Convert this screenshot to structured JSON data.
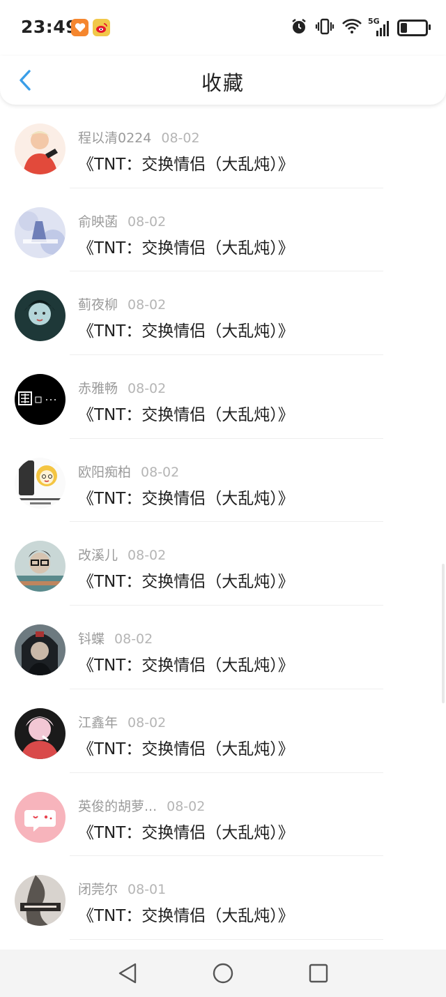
{
  "status_bar": {
    "time": "23:49",
    "network_label": "5G",
    "app_icons": [
      "heart-app-icon",
      "weibo-icon"
    ],
    "system_icons": [
      "alarm-icon",
      "vibrate-icon",
      "wifi-icon",
      "signal-icon",
      "battery-icon"
    ]
  },
  "header": {
    "title": "收藏",
    "back_icon": "chevron-left-icon",
    "accent_color": "#3a9ee8"
  },
  "items": [
    {
      "author": "程以清0224",
      "date": "08-02",
      "title": "《TNT：交换情侣（大乱炖）》",
      "avatar_colors": [
        "#e24a3b",
        "#f3c8a8"
      ]
    },
    {
      "author": "俞映菡",
      "date": "08-02",
      "title": "《TNT：交换情侣（大乱炖）》",
      "avatar_colors": [
        "#c9cfe8",
        "#6f7fb8"
      ]
    },
    {
      "author": "蓟夜柳",
      "date": "08-02",
      "title": "《TNT：交换情侣（大乱炖）》",
      "avatar_colors": [
        "#2f4f4f",
        "#b5d6d9"
      ]
    },
    {
      "author": "赤雅畅",
      "date": "08-02",
      "title": "《TNT：交换情侣（大乱炖）》",
      "avatar_colors": [
        "#000000",
        "#ffffff"
      ]
    },
    {
      "author": "欧阳痴柏",
      "date": "08-02",
      "title": "《TNT：交换情侣（大乱炖）》",
      "avatar_colors": [
        "#f5f5f5",
        "#f4c542"
      ]
    },
    {
      "author": "改溪儿",
      "date": "08-02",
      "title": "《TNT：交换情侣（大乱炖）》",
      "avatar_colors": [
        "#5a8a8c",
        "#d6c3b0"
      ]
    },
    {
      "author": "钭蝶",
      "date": "08-02",
      "title": "《TNT：交换情侣（大乱炖）》",
      "avatar_colors": [
        "#1c2024",
        "#c9b8a8"
      ]
    },
    {
      "author": "江鑫年",
      "date": "08-02",
      "title": "《TNT：交换情侣（大乱炖）》",
      "avatar_colors": [
        "#f2c7d4",
        "#e8a0b8"
      ]
    },
    {
      "author": "英俊的胡萝...",
      "date": "08-02",
      "title": "《TNT：交换情侣（大乱炖）》",
      "avatar_colors": [
        "#f7b4bc",
        "#e8434f"
      ]
    },
    {
      "author": "闭莞尔",
      "date": "08-01",
      "title": "《TNT：交换情侣（大乱炖）》",
      "avatar_colors": [
        "#5a5550",
        "#d8d3ce"
      ]
    }
  ],
  "nav_bar": {
    "buttons": [
      "back-triangle-icon",
      "home-circle-icon",
      "recent-square-icon"
    ]
  }
}
